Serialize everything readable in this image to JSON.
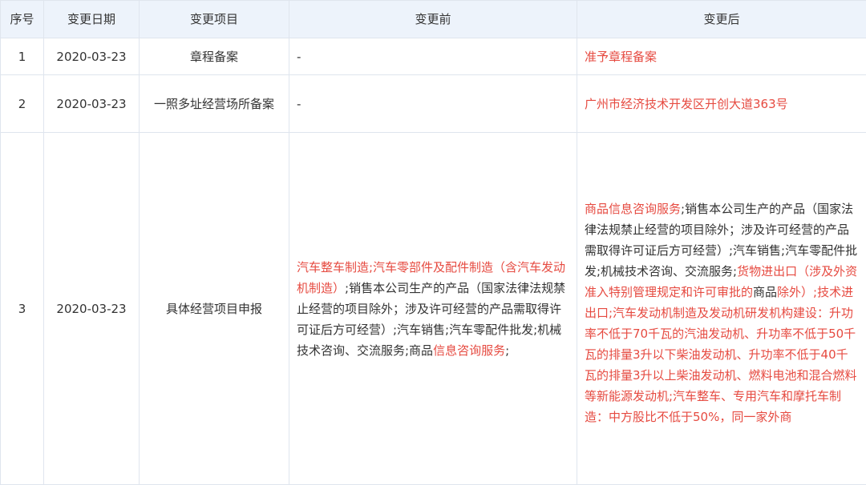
{
  "headers": [
    "序号",
    "变更日期",
    "变更项目",
    "变更前",
    "变更后"
  ],
  "rows": [
    {
      "no": "1",
      "date": "2020-03-23",
      "item": "章程备案",
      "before": "-",
      "after": "准予章程备案"
    },
    {
      "no": "2",
      "date": "2020-03-23",
      "item": "一照多址经营场所备案",
      "before": "-",
      "after": "广州市经济技术开发区开创大道363号"
    },
    {
      "no": "3",
      "date": "2020-03-23",
      "item": "具体经营项目申报",
      "before": {
        "p1": "汽车整车制造;汽车零部件及配件制造（含汽车发动机制造）",
        "p2": ";销售本公司生产的产品（国家法律法规禁止经营的项目除外；涉及许可经营的产品需取得许可证后方可经营）;汽车销售;汽车零配件批发;机械技术咨询、交流服务;商品",
        "p3": "信息咨询服务",
        "p4": ";"
      },
      "after": {
        "p1": "商品信息咨询服务",
        "p2": ";销售本公司生产的产品（国家法律法规禁止经营的项目除外；涉及许可经营的产品需取得许可证后方可经营）;汽车销售;汽车零配件批发;机械技术咨询、交流服务;",
        "p3": "货物进出口（涉及外资准入特别管理规定和许可审批的",
        "p4": "商品",
        "p5": "除外）;技术进出口;汽车发动机制造及发动机研发机构建设：升功率不低于70千瓦的汽油发动机、升功率不低于50千瓦的排量3升以下柴油发动机、升功率不低于40千瓦的排量3升以上柴油发动机、燃料电池和混合燃料等新能源发动机;汽车整车、专用汽车和摩托车制造：中方股比不低于50%，同一家外商"
      }
    }
  ]
}
